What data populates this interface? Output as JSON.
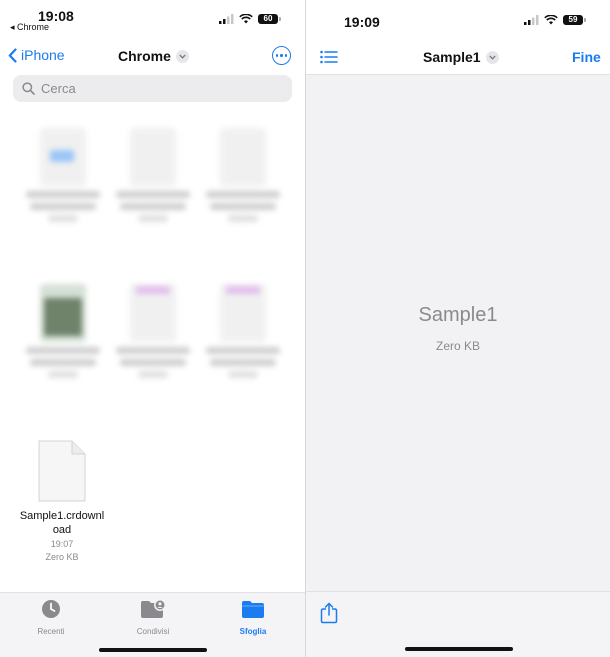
{
  "left": {
    "status": {
      "time": "19:08",
      "back_app": "◂ Chrome",
      "battery": "60"
    },
    "nav": {
      "back_label": "iPhone",
      "title": "Chrome"
    },
    "search": {
      "placeholder": "Cerca"
    },
    "file": {
      "name": "Sample1.crdownload",
      "date": "19:07",
      "size": "Zero KB"
    },
    "tabs": [
      {
        "label": "Recenti",
        "icon": "clock-icon",
        "active": false
      },
      {
        "label": "Condivisi",
        "icon": "shared-folder-icon",
        "active": false
      },
      {
        "label": "Sfoglia",
        "icon": "folder-icon",
        "active": true
      }
    ]
  },
  "right": {
    "status": {
      "time": "19:09",
      "battery": "59"
    },
    "nav": {
      "title": "Sample1",
      "done_label": "Fine"
    },
    "preview": {
      "name": "Sample1",
      "size": "Zero KB"
    }
  },
  "colors": {
    "accent": "#1a7cf0",
    "secondary_text": "#8a8a8e",
    "tab_bar": "#f4f4f6"
  }
}
